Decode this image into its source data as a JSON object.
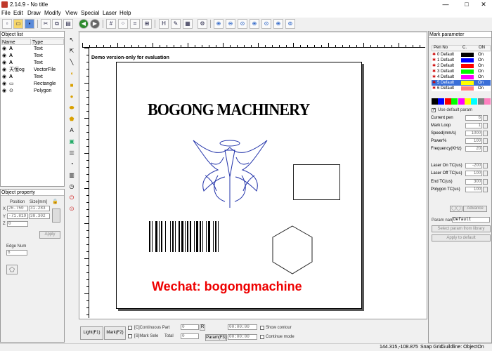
{
  "window": {
    "title": "2.14.9 - No title",
    "minimize": "—",
    "maximize": "□",
    "close": "✕"
  },
  "menu": [
    "File",
    "Edit",
    "Draw",
    "Modify",
    "View",
    "Special",
    "Laser",
    "Help"
  ],
  "toolbar": [
    "new-icon",
    "open-icon",
    "save-icon",
    "cut-icon",
    "copy-icon",
    "paste-icon",
    "undo-icon",
    "redo-icon",
    "grid-icon",
    "node-icon",
    "snap-icon",
    "group-icon",
    "h-align-icon",
    "edit-node-icon",
    "table-icon",
    "settings-icon",
    "zoom-in-icon",
    "zoom-out-icon",
    "zoom-fit-icon",
    "zoom-page-icon",
    "zoom-sel-icon",
    "zoom-box-icon",
    "pan-icon"
  ],
  "object_list": {
    "title": "Object list",
    "headers": [
      "Name",
      "Type"
    ],
    "rows": [
      {
        "name": "A",
        "type": "Text"
      },
      {
        "name": "A",
        "type": "Text"
      },
      {
        "name": "A",
        "type": "Text"
      },
      {
        "name": "天恒og",
        "type": "VectorFile"
      },
      {
        "name": "A",
        "type": "Text"
      },
      {
        "name": "",
        "type": "Rectangle"
      },
      {
        "name": "",
        "type": "Polygon"
      }
    ]
  },
  "object_property": {
    "title": "Object property",
    "position_label": "Position",
    "size_label": "Size[mm]",
    "x_label": "X",
    "y_label": "Y",
    "z_label": "Z",
    "x_pos": "26.750",
    "y_pos": "-71.819",
    "z_pos": "0",
    "x_size": "31.283",
    "y_size": "38.302",
    "apply": "Apply",
    "edge_num_label": "Edge Num",
    "edge_num": "6"
  },
  "canvas": {
    "demo_text": "Demo version-only for evaluation",
    "headline": "BOGONG MACHINERY",
    "wechat": "Wechat: bogongmachine"
  },
  "bottom": {
    "light": "Light(F1)",
    "mark": "Mark(F2)",
    "continuous_part": "[C]Continuous Part",
    "mark_sele": "[S]Mark Sele",
    "total": "Total",
    "part_val": "0",
    "total_val": "0",
    "r_btn": "R",
    "time1": "00:00:00",
    "time2": "00:00:00",
    "param": "Param(F3)",
    "show_contour": "Show contour",
    "continue_mode": "Continue mode"
  },
  "status": {
    "coords": "144.315,-108.875",
    "snap": "Snap Grid",
    "guideline": "Guildline: ObjectOn"
  },
  "mark_param": {
    "title": "Mark parameter",
    "headers": [
      "Pen No",
      "C.",
      "ON"
    ],
    "pens": [
      {
        "label": "0 Default",
        "color": "#000000",
        "on": "On"
      },
      {
        "label": "1 Default",
        "color": "#0000ff",
        "on": "On"
      },
      {
        "label": "2 Default",
        "color": "#ff0000",
        "on": "On"
      },
      {
        "label": "3 Default",
        "color": "#00ff00",
        "on": "On"
      },
      {
        "label": "4 Default",
        "color": "#ff00ff",
        "on": "On"
      },
      {
        "label": "5 Default",
        "color": "#ffff00",
        "on": "On"
      },
      {
        "label": "6 Default",
        "color": "#ff8080",
        "on": "On"
      }
    ],
    "palette": [
      "#000000",
      "#0000ff",
      "#ff0000",
      "#00ff00",
      "#ff00ff",
      "#ffff00",
      "#00ffff",
      "#808080",
      "#ff80c0"
    ],
    "use_default": "Use default param",
    "rows": [
      {
        "label": "Current pen",
        "value": "6"
      },
      {
        "label": "Mark Loop",
        "value": "1"
      },
      {
        "label": "Speed(mm/s)",
        "value": "1000"
      },
      {
        "label": "Power%",
        "value": "100"
      },
      {
        "label": "Frequency(KHz)",
        "value": "20"
      },
      {
        "label": "Laser On TC(us)",
        "value": "-200"
      },
      {
        "label": "Laser Off TC(us)",
        "value": "100"
      },
      {
        "label": "End TC(us)",
        "value": "300"
      },
      {
        "label": "Polygon TC(us)",
        "value": "100"
      }
    ],
    "advance": "Advance",
    "param_name_label": "Param name:",
    "param_name": "Default",
    "select_lib": "Select param from library",
    "apply_default": "Apply to default"
  }
}
